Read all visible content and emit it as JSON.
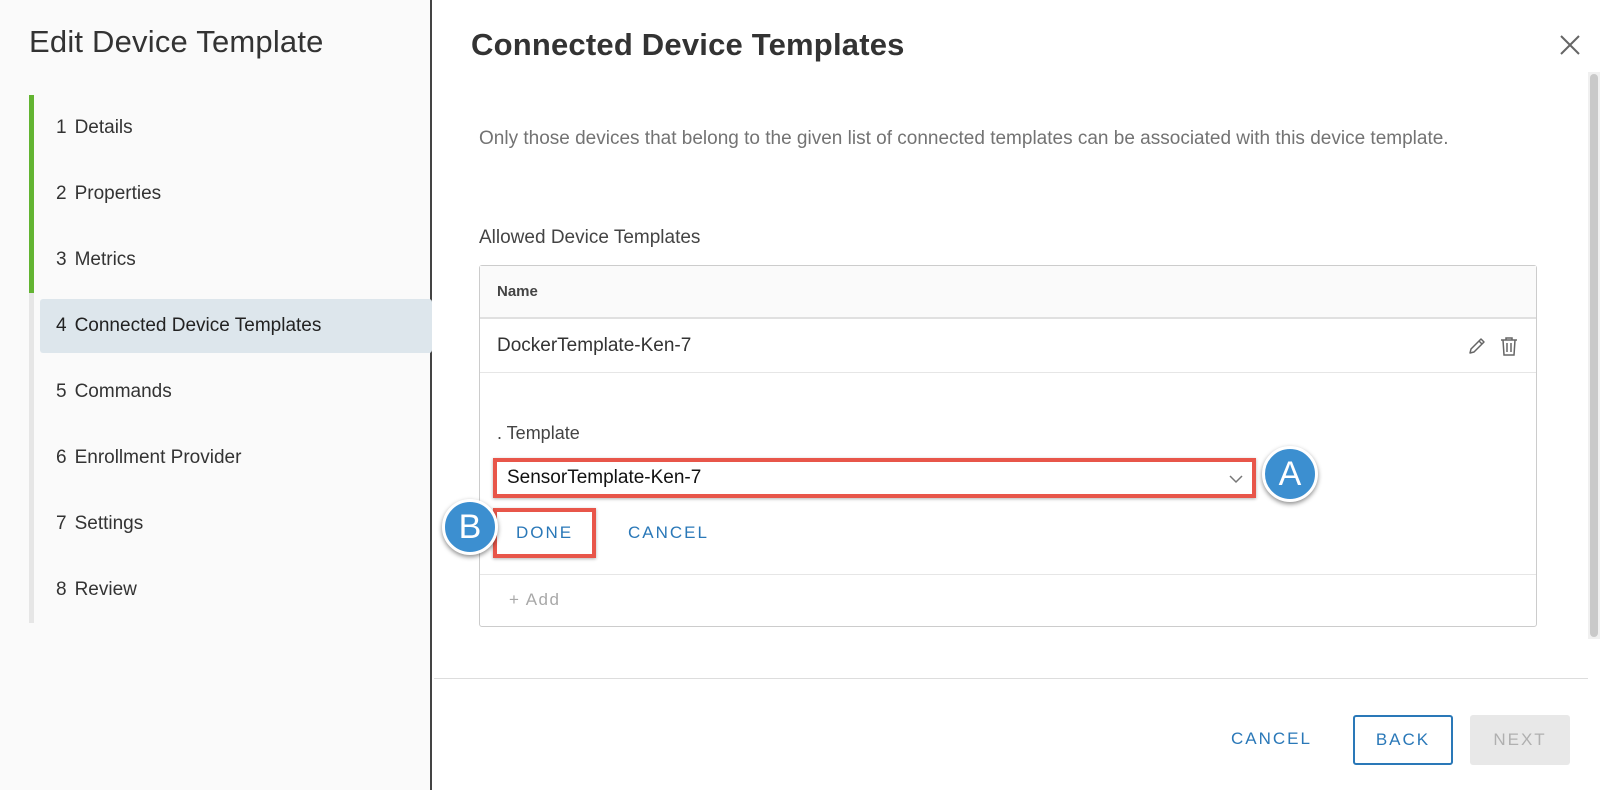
{
  "sidebar": {
    "title": "Edit Device Template",
    "steps": [
      {
        "num": "1",
        "label": "Details",
        "state": "done"
      },
      {
        "num": "2",
        "label": "Properties",
        "state": "done"
      },
      {
        "num": "3",
        "label": "Metrics",
        "state": "done"
      },
      {
        "num": "4",
        "label": "Connected Device Templates",
        "state": "active"
      },
      {
        "num": "5",
        "label": "Commands",
        "state": "pending"
      },
      {
        "num": "6",
        "label": "Enrollment Provider",
        "state": "pending"
      },
      {
        "num": "7",
        "label": "Settings",
        "state": "pending"
      },
      {
        "num": "8",
        "label": "Review",
        "state": "pending"
      }
    ]
  },
  "main": {
    "title": "Connected Device Templates",
    "description": "Only those devices that belong to the given list of connected templates can be associated with this device template.",
    "section_label": "Allowed Device Templates",
    "table": {
      "column_name": "Name",
      "rows": [
        {
          "name": "DockerTemplate-Ken-7"
        }
      ],
      "editor": {
        "label": ". Template",
        "selected_value": "SensorTemplate-Ken-7",
        "done_label": "DONE",
        "cancel_label": "CANCEL"
      },
      "add_label": "+ Add"
    }
  },
  "annotations": {
    "a": "A",
    "b": "B"
  },
  "footer": {
    "cancel_label": "CANCEL",
    "back_label": "BACK",
    "next_label": "NEXT"
  },
  "colors": {
    "accent": "#2a78b8",
    "progress_done": "#62b431",
    "highlight": "#e8564a",
    "badge": "#3c8fd0"
  }
}
